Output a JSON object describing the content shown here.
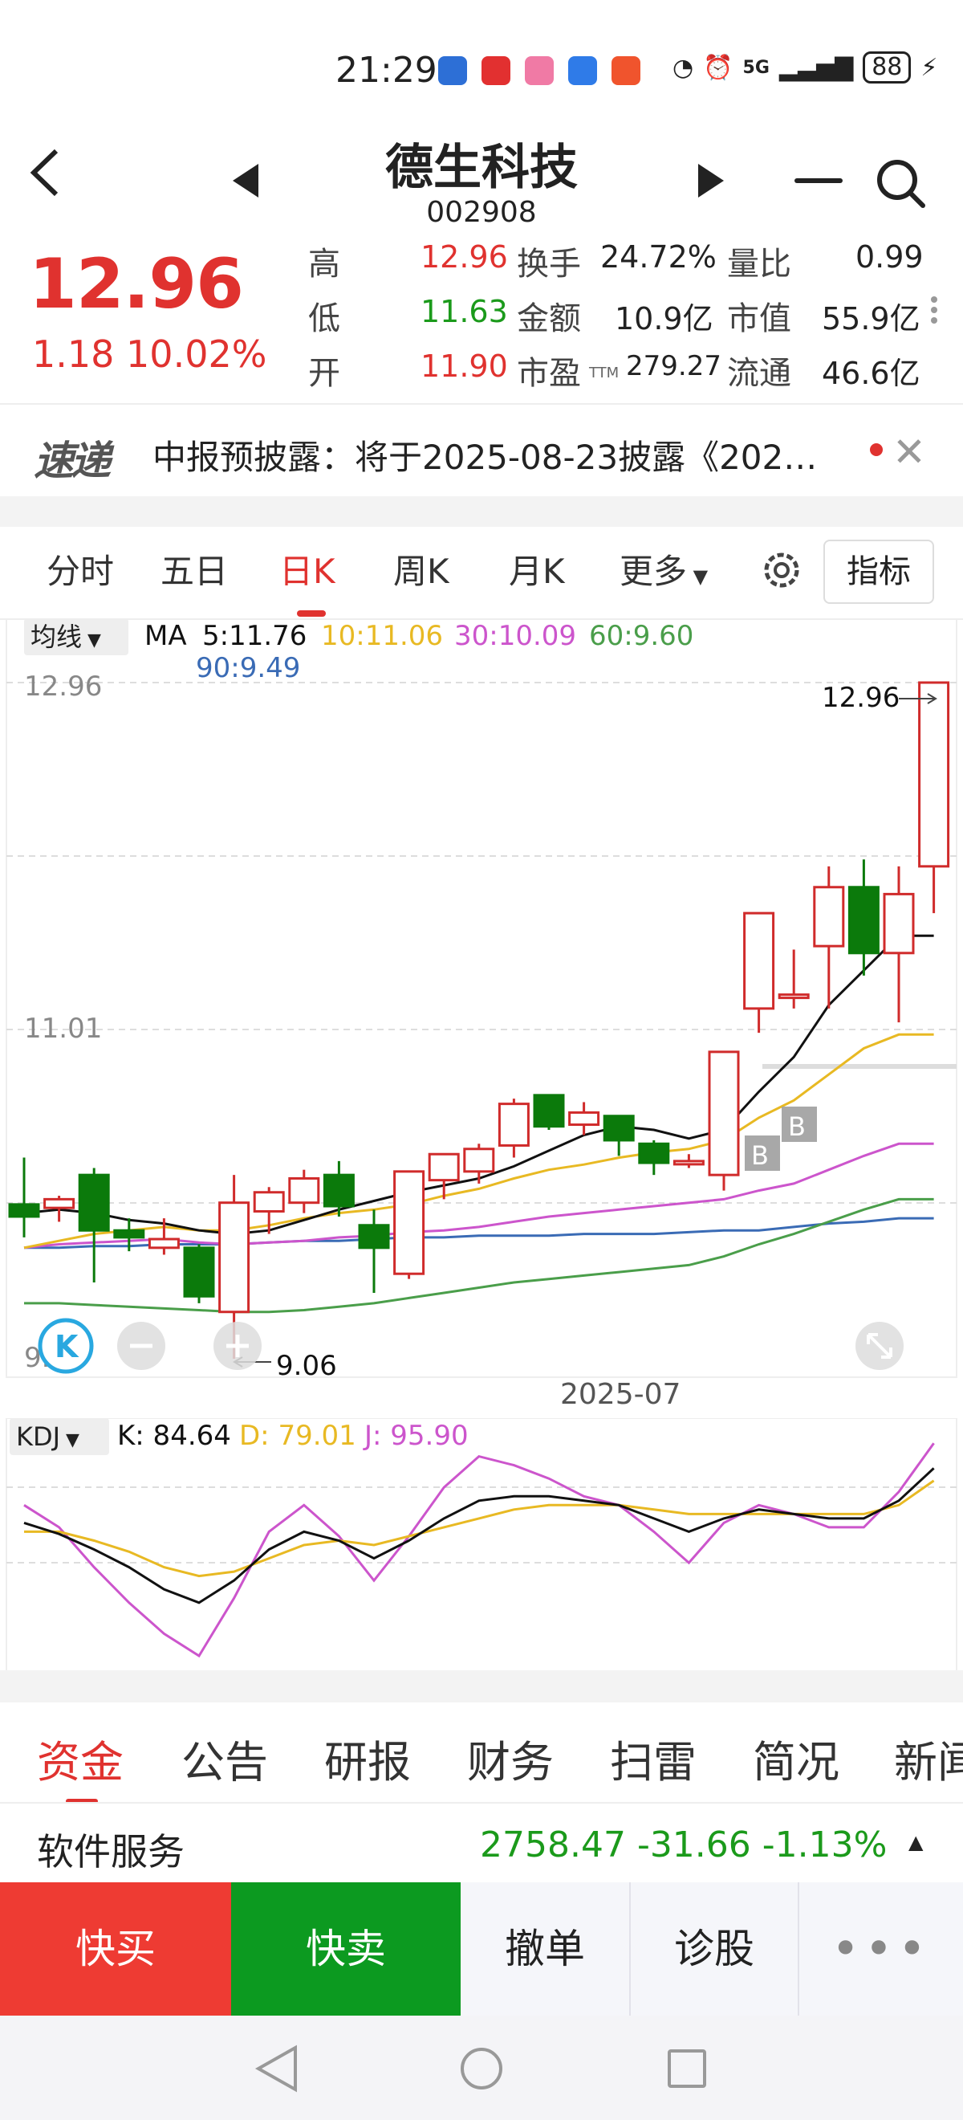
{
  "status": {
    "time": "21:29",
    "network": "5G",
    "battery": "88"
  },
  "header": {
    "name": "德生科技",
    "code": "002908"
  },
  "quote": {
    "price": "12.96",
    "change": "1.18 10.02%",
    "high_label": "高",
    "high": "12.96",
    "low_label": "低",
    "low": "11.63",
    "open_label": "开",
    "open": "11.90",
    "turnover_label": "换手",
    "turnover": "24.72%",
    "amount_label": "金额",
    "amount": "10.9亿",
    "pe_label": "市盈",
    "pe_sub": "TTM",
    "pe": "279.27",
    "vol_ratio_label": "量比",
    "vol_ratio": "0.99",
    "mcap_label": "市值",
    "mcap": "55.9亿",
    "float_label": "流通",
    "float_cap": "46.6亿"
  },
  "news": {
    "logo": "速递",
    "text": "中报预披露：将于2025-08-23披露《202…"
  },
  "period_tabs": [
    "分时",
    "五日",
    "日K",
    "周K",
    "月K",
    "更多"
  ],
  "indicator_button": "指标",
  "ma": {
    "dropdown": "均线",
    "prefix": "MA",
    "ma5": "5:11.76",
    "ma10": "10:11.06",
    "ma30": "30:10.09",
    "ma60": "60:9.60",
    "ma90": "90:9.49",
    "colors": {
      "ma5": "#111111",
      "ma10": "#e8b923",
      "ma30": "#cc55cc",
      "ma60": "#4a9e4a",
      "ma90": "#3a6bb5"
    }
  },
  "chart_labels": {
    "y_top": "12.96",
    "y_mid": "11.01",
    "y_low": "9.06",
    "max_marker": "12.96",
    "min_marker": "9.06",
    "x_label": "2025-07",
    "buy_marker": "B"
  },
  "kdj": {
    "dropdown": "KDJ",
    "k": "K: 84.64",
    "d": "D: 79.01",
    "j": "J: 95.90"
  },
  "info_tabs": [
    "资金",
    "公告",
    "研报",
    "财务",
    "扫雷",
    "简况",
    "新闻"
  ],
  "sector": {
    "name": "软件服务",
    "index": "2758.47  -31.66  -1.13%"
  },
  "actions": {
    "buy": "快买",
    "sell": "快卖",
    "cancel": "撤单",
    "diagnose": "诊股",
    "more": "•••"
  },
  "chart_data": {
    "type": "candlestick",
    "x_label": "2025-07",
    "y_range": [
      9.06,
      12.96
    ],
    "candles": [
      {
        "o": 9.95,
        "h": 10.22,
        "l": 9.76,
        "c": 9.88
      },
      {
        "o": 9.93,
        "h": 10.0,
        "l": 9.85,
        "c": 9.98
      },
      {
        "o": 10.12,
        "h": 10.16,
        "l": 9.5,
        "c": 9.8
      },
      {
        "o": 9.8,
        "h": 9.87,
        "l": 9.68,
        "c": 9.76
      },
      {
        "o": 9.7,
        "h": 9.87,
        "l": 9.66,
        "c": 9.75
      },
      {
        "o": 9.7,
        "h": 9.72,
        "l": 9.38,
        "c": 9.42
      },
      {
        "o": 9.33,
        "h": 10.12,
        "l": 9.06,
        "c": 9.96
      },
      {
        "o": 9.91,
        "h": 10.05,
        "l": 9.78,
        "c": 10.02
      },
      {
        "o": 9.96,
        "h": 10.15,
        "l": 9.9,
        "c": 10.1
      },
      {
        "o": 10.12,
        "h": 10.2,
        "l": 9.88,
        "c": 9.94
      },
      {
        "o": 9.83,
        "h": 9.92,
        "l": 9.44,
        "c": 9.7
      },
      {
        "o": 9.55,
        "h": 10.14,
        "l": 9.52,
        "c": 10.14
      },
      {
        "o": 10.09,
        "h": 10.24,
        "l": 9.98,
        "c": 10.24
      },
      {
        "o": 10.14,
        "h": 10.3,
        "l": 10.07,
        "c": 10.27
      },
      {
        "o": 10.29,
        "h": 10.56,
        "l": 10.22,
        "c": 10.53
      },
      {
        "o": 10.58,
        "h": 10.58,
        "l": 10.38,
        "c": 10.4
      },
      {
        "o": 10.41,
        "h": 10.54,
        "l": 10.35,
        "c": 10.48
      },
      {
        "o": 10.46,
        "h": 10.46,
        "l": 10.23,
        "c": 10.32
      },
      {
        "o": 10.3,
        "h": 10.32,
        "l": 10.12,
        "c": 10.19
      },
      {
        "o": 10.19,
        "h": 10.24,
        "l": 10.16,
        "c": 10.2
      },
      {
        "o": 10.12,
        "h": 10.83,
        "l": 10.03,
        "c": 10.83
      },
      {
        "o": 11.08,
        "h": 11.61,
        "l": 10.94,
        "c": 11.63
      },
      {
        "o": 11.16,
        "h": 11.42,
        "l": 11.08,
        "c": 11.16
      },
      {
        "o": 11.44,
        "h": 11.9,
        "l": 11.08,
        "c": 11.78
      },
      {
        "o": 11.78,
        "h": 11.94,
        "l": 11.27,
        "c": 11.4
      },
      {
        "o": 11.4,
        "h": 11.9,
        "l": 11.0,
        "c": 11.74
      },
      {
        "o": 11.9,
        "h": 12.96,
        "l": 11.63,
        "c": 12.96
      }
    ],
    "ma5": [
      9.9,
      9.92,
      9.9,
      9.86,
      9.84,
      9.8,
      9.78,
      9.8,
      9.86,
      9.92,
      9.97,
      10.02,
      10.06,
      10.1,
      10.17,
      10.26,
      10.35,
      10.4,
      10.38,
      10.33,
      10.38,
      10.6,
      10.8,
      11.1,
      11.3,
      11.5,
      11.76
    ],
    "ma10": [
      9.7,
      9.74,
      9.78,
      9.8,
      9.82,
      9.8,
      9.8,
      9.83,
      9.87,
      9.9,
      9.92,
      9.95,
      10.0,
      10.04,
      10.1,
      10.15,
      10.18,
      10.22,
      10.25,
      10.27,
      10.32,
      10.45,
      10.55,
      10.7,
      10.85,
      10.93,
      11.06
    ],
    "ma30": [
      9.7,
      9.72,
      9.73,
      9.74,
      9.75,
      9.73,
      9.72,
      9.73,
      9.74,
      9.76,
      9.77,
      9.79,
      9.8,
      9.82,
      9.85,
      9.88,
      9.9,
      9.92,
      9.94,
      9.96,
      9.98,
      10.03,
      10.07,
      10.15,
      10.23,
      10.3,
      10.09
    ],
    "ma60": [
      9.38,
      9.38,
      9.37,
      9.36,
      9.35,
      9.34,
      9.33,
      9.33,
      9.34,
      9.36,
      9.38,
      9.41,
      9.44,
      9.47,
      9.5,
      9.52,
      9.54,
      9.56,
      9.58,
      9.6,
      9.65,
      9.72,
      9.78,
      9.85,
      9.92,
      9.98,
      9.6
    ],
    "ma90": [
      9.7,
      9.7,
      9.71,
      9.71,
      9.72,
      9.72,
      9.72,
      9.73,
      9.74,
      9.74,
      9.75,
      9.76,
      9.76,
      9.77,
      9.77,
      9.77,
      9.78,
      9.78,
      9.78,
      9.79,
      9.8,
      9.8,
      9.82,
      9.84,
      9.85,
      9.87,
      9.49
    ],
    "kdj": {
      "k": [
        60,
        55,
        48,
        40,
        30,
        24,
        34,
        48,
        56,
        52,
        44,
        52,
        62,
        70,
        72,
        72,
        70,
        68,
        62,
        56,
        62,
        66,
        64,
        62,
        62,
        70,
        84.64
      ],
      "d": [
        56,
        56,
        52,
        47,
        40,
        36,
        38,
        44,
        50,
        52,
        50,
        54,
        58,
        62,
        66,
        68,
        68,
        68,
        66,
        64,
        64,
        64,
        64,
        64,
        64,
        68,
        79.01
      ],
      "j": [
        68,
        58,
        40,
        24,
        10,
        0,
        26,
        56,
        68,
        54,
        34,
        54,
        76,
        90,
        86,
        80,
        72,
        68,
        56,
        42,
        60,
        68,
        64,
        58,
        58,
        74,
        95.9
      ]
    }
  }
}
